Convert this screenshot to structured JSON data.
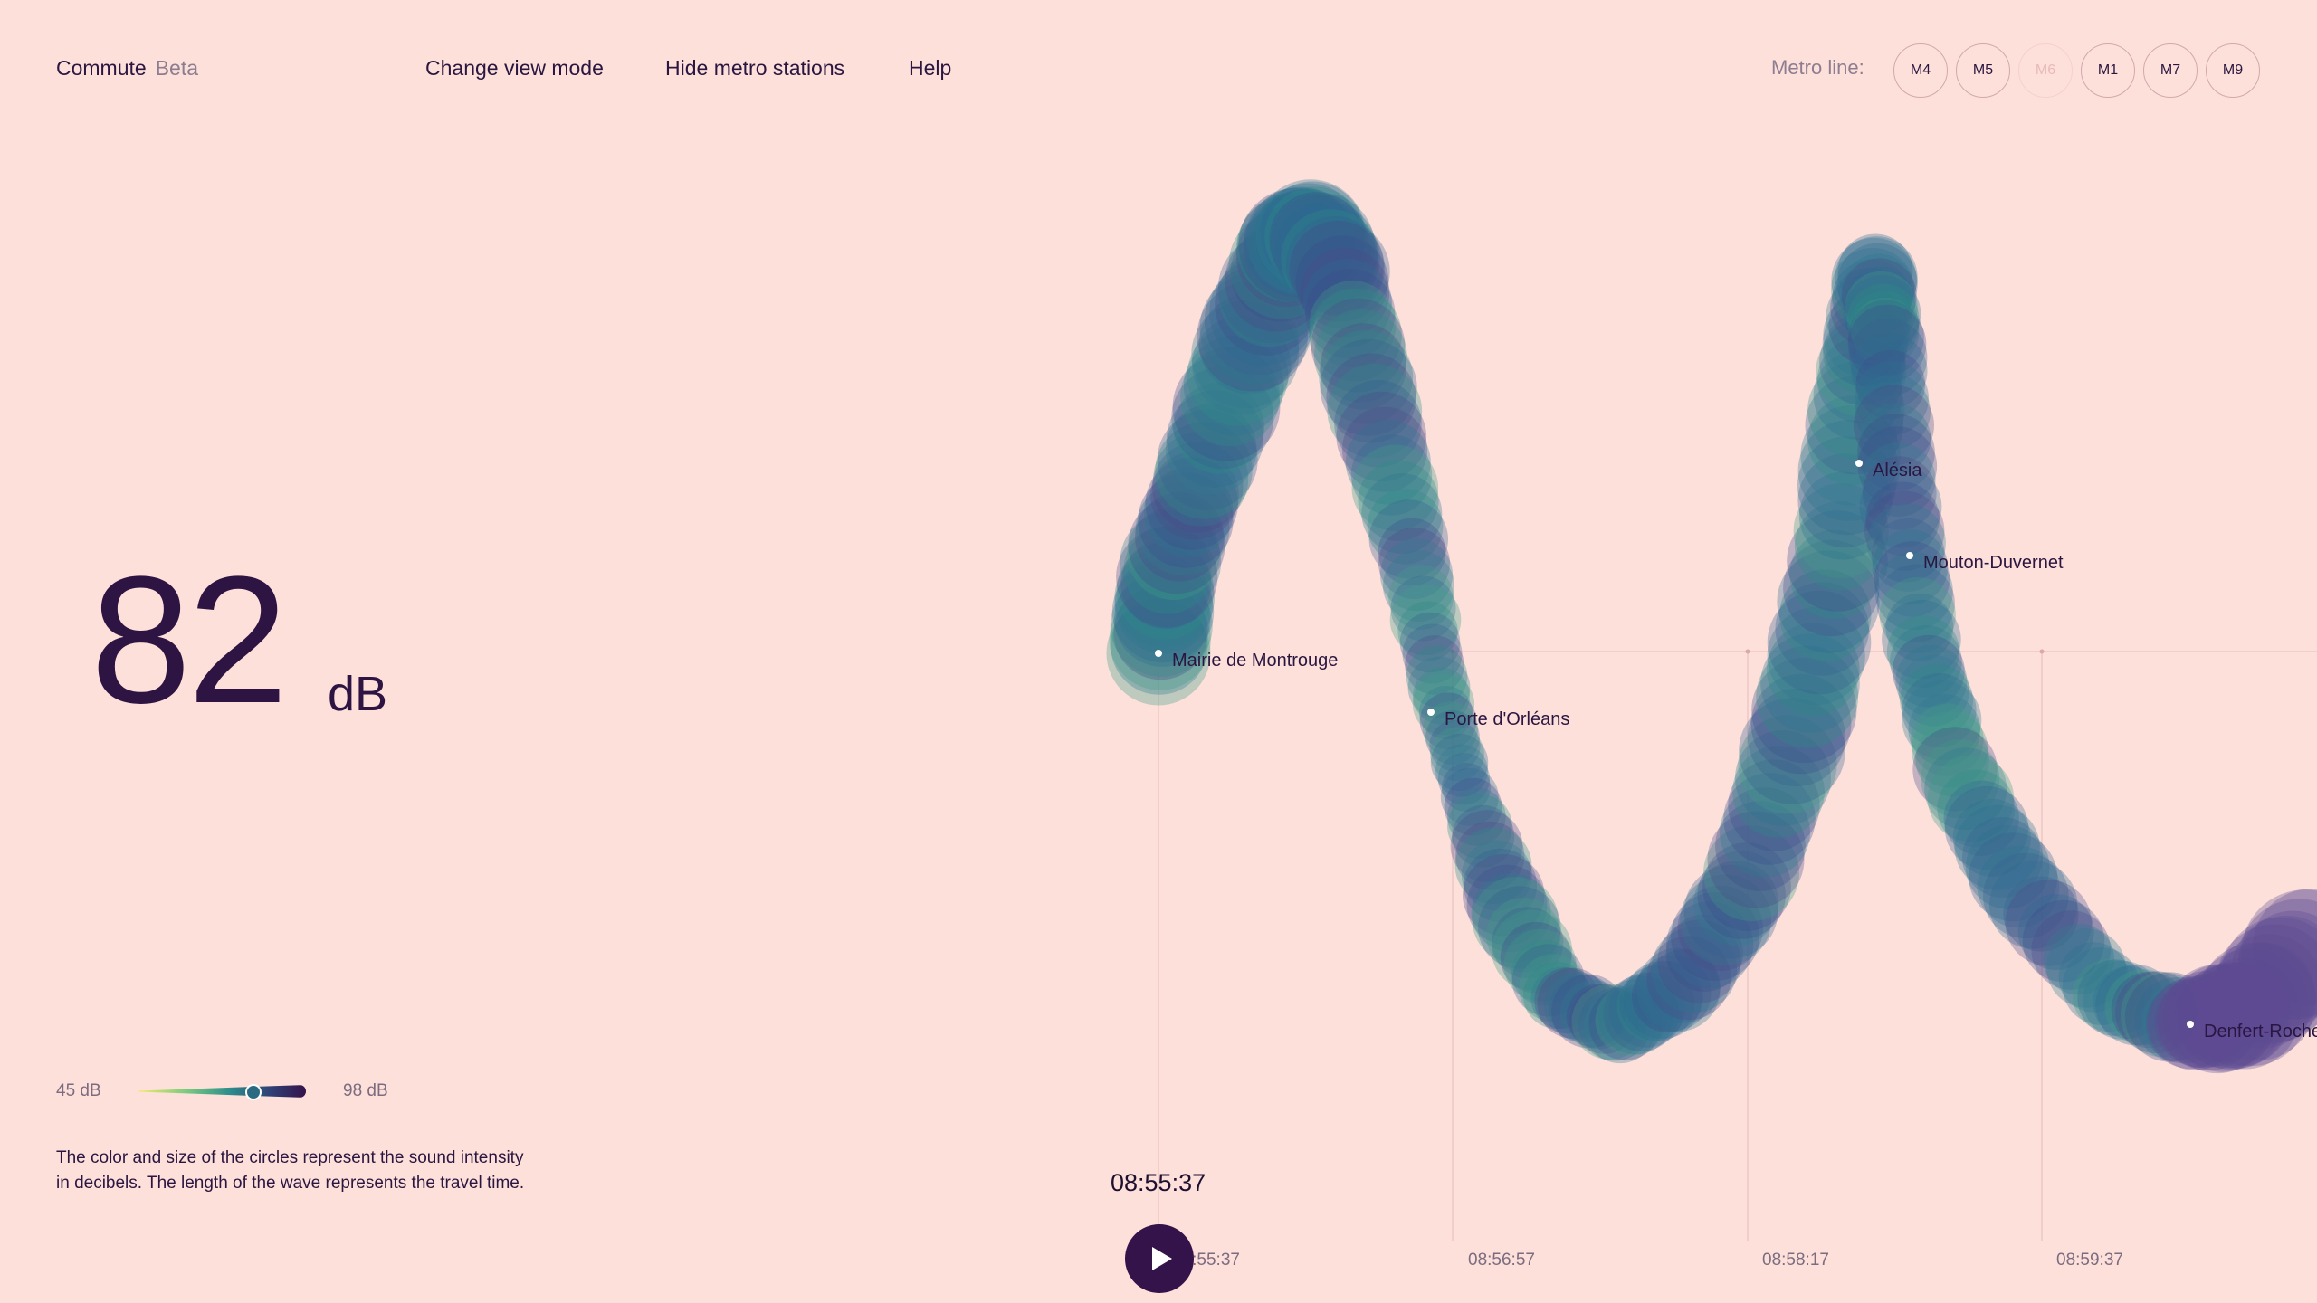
{
  "header": {
    "app_name": "Commute",
    "app_badge": "Beta",
    "nav": [
      "Change view mode",
      "Hide metro stations",
      "Help"
    ],
    "metro_label": "Metro line:",
    "lines": [
      {
        "label": "M4",
        "enabled": true
      },
      {
        "label": "M5",
        "enabled": true
      },
      {
        "label": "M6",
        "enabled": false
      },
      {
        "label": "M1",
        "enabled": true
      },
      {
        "label": "M7",
        "enabled": true
      },
      {
        "label": "M9",
        "enabled": true
      }
    ]
  },
  "readout": {
    "value": "82",
    "unit": "dB"
  },
  "legend": {
    "min_label": "45 dB",
    "max_label": "98 dB",
    "current_fraction": 0.69
  },
  "description": "The color and size of the circles represent the sound intensity in decibels. The length of the wave represents the travel time.",
  "timeline": {
    "current_time": "08:55:37",
    "ticks": [
      "08:55:37",
      "08:56:57",
      "08:58:17",
      "08:59:37"
    ]
  },
  "stations": [
    "Mairie de Montrouge",
    "Porte d'Orléans",
    "Alésia",
    "Mouton-Duvernet",
    "Denfert-Rochereau"
  ],
  "colors": {
    "background": "#fde0da",
    "text": "#2a1640",
    "play_button": "#34124a",
    "scale_low": "#f4ea6a",
    "scale_mid": "#2c8d8b",
    "scale_high": "#34134a"
  }
}
